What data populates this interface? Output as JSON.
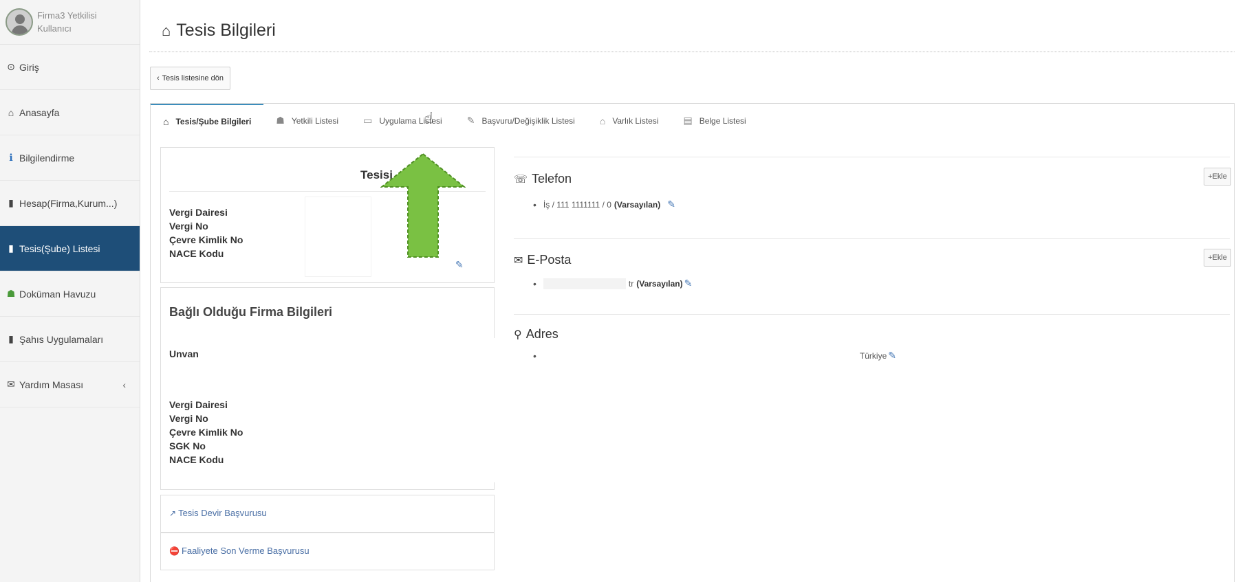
{
  "sidebar": {
    "user": {
      "name": "Firma3 Yetkilisi",
      "role": "Kullanıcı"
    },
    "items": [
      {
        "label": "Giriş",
        "icon": "arrow-circle-icon"
      },
      {
        "label": "Anasayfa",
        "icon": "home-icon"
      },
      {
        "label": "Bilgilendirme",
        "icon": "info-icon"
      },
      {
        "label": "Hesap(Firma,Kurum...)",
        "icon": "building-icon"
      },
      {
        "label": "Tesis(Şube) Listesi",
        "icon": "building-icon",
        "active": true
      },
      {
        "label": "Doküman Havuzu",
        "icon": "users-icon"
      },
      {
        "label": "Şahıs Uygulamaları",
        "icon": "building-icon"
      },
      {
        "label": "Yardım Masası",
        "icon": "envelope-icon"
      }
    ]
  },
  "page": {
    "title": "Tesis Bilgileri",
    "back_label": "Tesis listesine dön"
  },
  "tabs": [
    {
      "label": "Tesis/Şube Bilgileri",
      "icon": "home-icon",
      "active": true
    },
    {
      "label": "Yetkili Listesi",
      "icon": "users-icon"
    },
    {
      "label": "Uygulama Listesi",
      "icon": "laptop-icon"
    },
    {
      "label": "Başvuru/Değişiklik Listesi",
      "icon": "edit-icon"
    },
    {
      "label": "Varlık Listesi",
      "icon": "home-icon"
    },
    {
      "label": "Belge Listesi",
      "icon": "file-icon"
    }
  ],
  "tesis_box": {
    "heading": "Tesisi",
    "labels": [
      "Vergi Dairesi",
      "Vergi No",
      "Çevre Kimlik No",
      "NACE Kodu"
    ]
  },
  "firma_box": {
    "title": "Bağlı Olduğu Firma Bilgileri",
    "unvan_label": "Unvan",
    "labels": [
      "Vergi Dairesi",
      "Vergi No",
      "Çevre Kimlik No",
      "SGK No",
      "NACE Kodu"
    ]
  },
  "links": {
    "devir": "Tesis Devir Başvurusu",
    "son_verme": "Faaliyete Son Verme Başvurusu"
  },
  "contact": {
    "telefon": {
      "title": "Telefon",
      "line": "İş / 111 1111111 / 0",
      "default_label": "(Varsayılan)"
    },
    "eposta": {
      "title": "E-Posta",
      "suffix": "tr",
      "default_label": "(Varsayılan)"
    },
    "adres": {
      "title": "Adres",
      "country": "Türkiye"
    },
    "add_label": "Ekle"
  },
  "colors": {
    "active_nav": "#1e4e78",
    "tab_accent": "#3c8dbc",
    "arrow_green": "#7ac143"
  }
}
